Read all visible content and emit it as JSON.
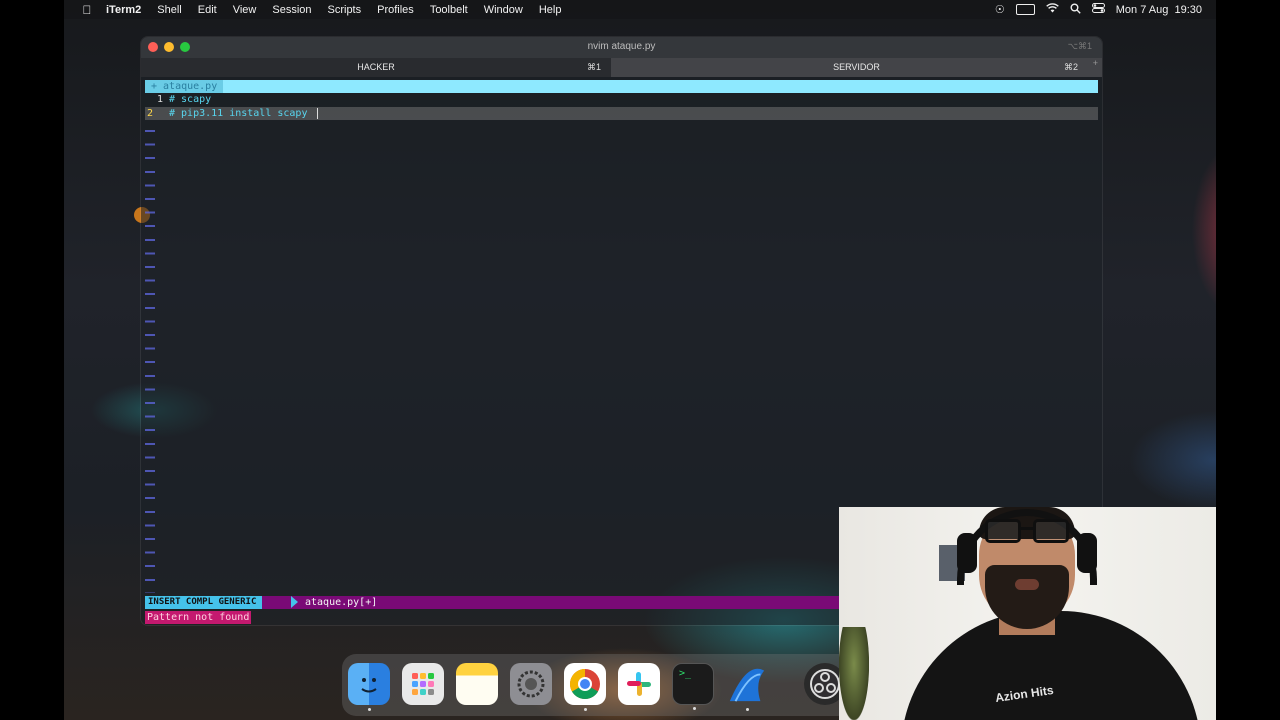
{
  "menubar": {
    "apple_icon": "apple-logo-icon",
    "items": [
      "iTerm2",
      "Shell",
      "Edit",
      "View",
      "Session",
      "Scripts",
      "Profiles",
      "Toolbelt",
      "Window",
      "Help"
    ],
    "status_icons": [
      "focus-icon",
      "battery-icon",
      "wifi-icon",
      "search-icon",
      "control-center-icon"
    ],
    "datetime": "Mon 7 Aug  19:30"
  },
  "window": {
    "title": "nvim ataque.py",
    "shortcut": "⌥⌘1",
    "tabs": [
      {
        "label": "HACKER",
        "key": "⌘1",
        "active": true
      },
      {
        "label": "SERVIDOR",
        "key": "⌘2",
        "active": false
      }
    ],
    "new_tab": "+"
  },
  "vim": {
    "tab_label": "+ ataque.py",
    "lines": [
      {
        "number": "1",
        "text": "# scapy"
      },
      {
        "number": "2",
        "text": "# pip3.11 install scapy "
      }
    ],
    "mode": "INSERT COMPL GENERIC",
    "filename": "ataque.py[+]",
    "message": "Pattern not found",
    "colors": {
      "tabline": "#8ee9ff",
      "mode": "#45c2ea",
      "statusline": "#7a0a76",
      "error": "#c4196f",
      "tilde": "#5a63d6"
    }
  },
  "dock": {
    "apps": [
      "finder-icon",
      "launchpad-icon",
      "notes-icon",
      "system-settings-icon",
      "chrome-icon",
      "slack-icon",
      "terminal-icon",
      "wireshark-icon",
      "obs-icon"
    ]
  },
  "webcam": {
    "shirt_text": "Azion Hits"
  }
}
